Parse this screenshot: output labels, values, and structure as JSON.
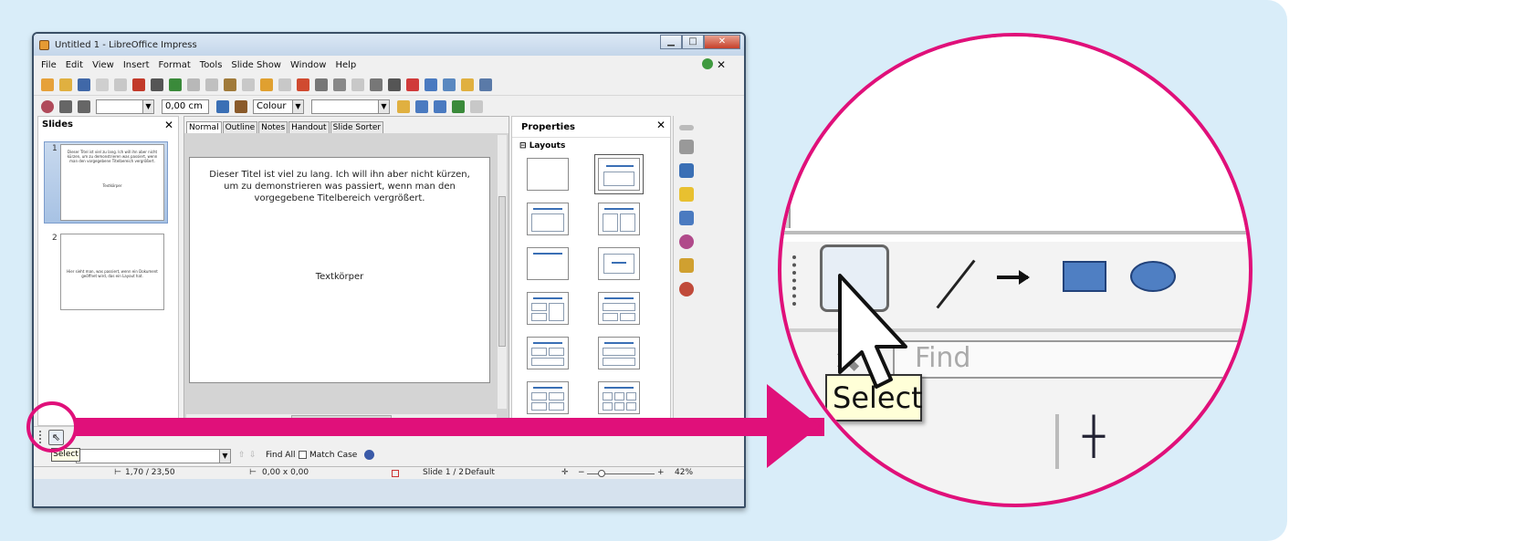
{
  "window": {
    "title": "Untitled 1 - LibreOffice Impress",
    "min": "▁",
    "max": "□",
    "close": "✕"
  },
  "menu": {
    "items": [
      "File",
      "Edit",
      "View",
      "Insert",
      "Format",
      "Tools",
      "Slide Show",
      "Window",
      "Help"
    ],
    "close": "✕"
  },
  "line_toolbar": {
    "line_width": "0,00 cm",
    "area_style": "Colour"
  },
  "slides_pane": {
    "title": "Slides",
    "close": "✕",
    "slides": [
      {
        "number": "1",
        "title_text": "Dieser Titel ist viel zu lang. Ich will ihn aber nicht kürzen, um zu demonstrieren was passiert, wenn man den vorgegebene Titelbereich vergrößert.",
        "body_text": "Textkörper"
      },
      {
        "number": "2",
        "title_text": "Hier sieht man, was passiert, wenn ein Dokument geöffnet wird, das ein Layout hat."
      }
    ]
  },
  "editor": {
    "tabs": [
      "Normal",
      "Outline",
      "Notes",
      "Handout",
      "Slide Sorter"
    ],
    "active_tab": "Normal",
    "slide_title": "Dieser Titel ist viel zu lang. Ich will ihn aber nicht kürzen, um zu demonstrieren was passiert, wenn man den vorgegebene Titelbereich vergrößert.",
    "slide_body": "Textkörper"
  },
  "properties": {
    "title": "Properties",
    "close": "✕",
    "section": "Layouts",
    "section_toggle": "⊟"
  },
  "find_toolbar": {
    "find_all": "Find All",
    "match_case": "Match Case"
  },
  "status_bar": {
    "position": "1,70 / 23,50",
    "size": "0,00 x 0,00",
    "slide": "Slide 1 / 2",
    "master": "Default",
    "zoom": "42%"
  },
  "tooltip": "Select",
  "zoom_view": {
    "find_text": "Find",
    "tooltip": "Select"
  },
  "colors": {
    "accent": "#e0107a",
    "background": "#d9edf9",
    "layout_line": "#3a6fb5"
  }
}
